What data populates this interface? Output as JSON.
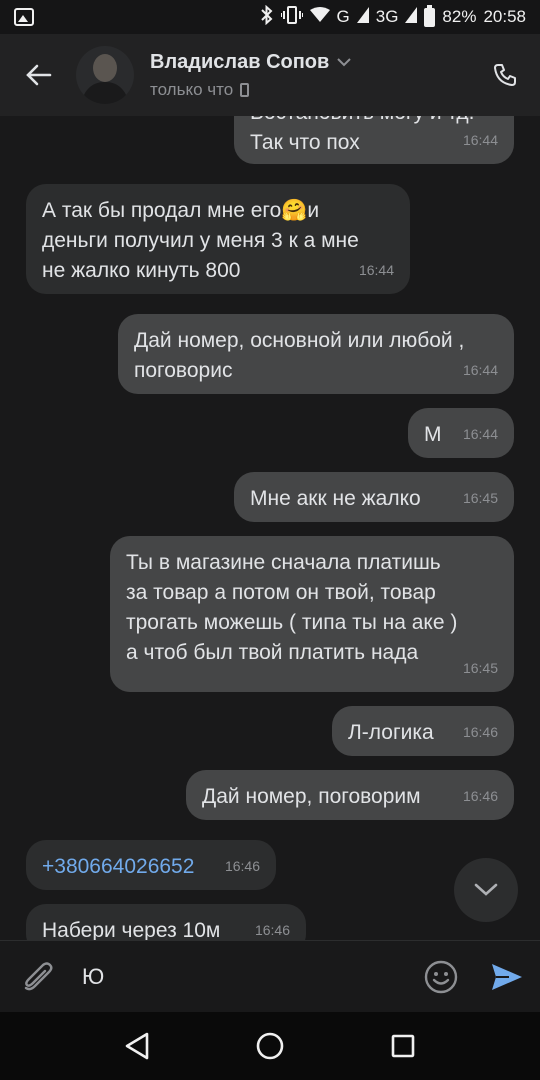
{
  "status_bar": {
    "signal_labels": [
      "G",
      "3G"
    ],
    "battery": "82%",
    "time": "20:58"
  },
  "header": {
    "contact_name": "Владислав Сопов",
    "contact_status": "только что"
  },
  "messages": [
    {
      "dir": "out",
      "text": "Востановить могу и тд.\nТак что пох",
      "time": "16:44"
    },
    {
      "dir": "in",
      "text": "А так бы продал мне его🤗и\nденьги получил у меня 3 к а мне\nне жалко кинуть 800",
      "time": "16:44"
    },
    {
      "dir": "out",
      "text": "Дай номер, основной или любой ,\nпоговорис",
      "time": "16:44"
    },
    {
      "dir": "out",
      "text": "М",
      "time": "16:44"
    },
    {
      "dir": "out",
      "text": "Мне акк не жалко",
      "time": "16:45"
    },
    {
      "dir": "out",
      "text": "Ты в магазине сначала платишь\nза товар а потом он твой, товар\nтрогать можешь ( типа ты на аке )\nа чтоб был твой платить нада",
      "time": "16:45"
    },
    {
      "dir": "out",
      "text": "Л-логика",
      "time": "16:46"
    },
    {
      "dir": "out",
      "text": "Дай номер, поговорим",
      "time": "16:46"
    },
    {
      "dir": "in",
      "text": "+380664026652",
      "time": "16:46"
    },
    {
      "dir": "in",
      "text": "Набери через 10м",
      "time": "16:46"
    }
  ],
  "composer": {
    "value": "Ю"
  },
  "icons": {
    "back": "arrow-left-icon",
    "call": "phone-icon",
    "attach": "paperclip-icon",
    "emoji": "smile-icon",
    "send": "send-icon",
    "scroll_down": "chevron-down-icon"
  },
  "colors": {
    "background": "#19191a",
    "header": "#222223",
    "incoming_bubble": "#2c2d2e",
    "outgoing_bubble": "#454647",
    "link": "#71aaeb",
    "send_accent": "#71aaeb"
  }
}
